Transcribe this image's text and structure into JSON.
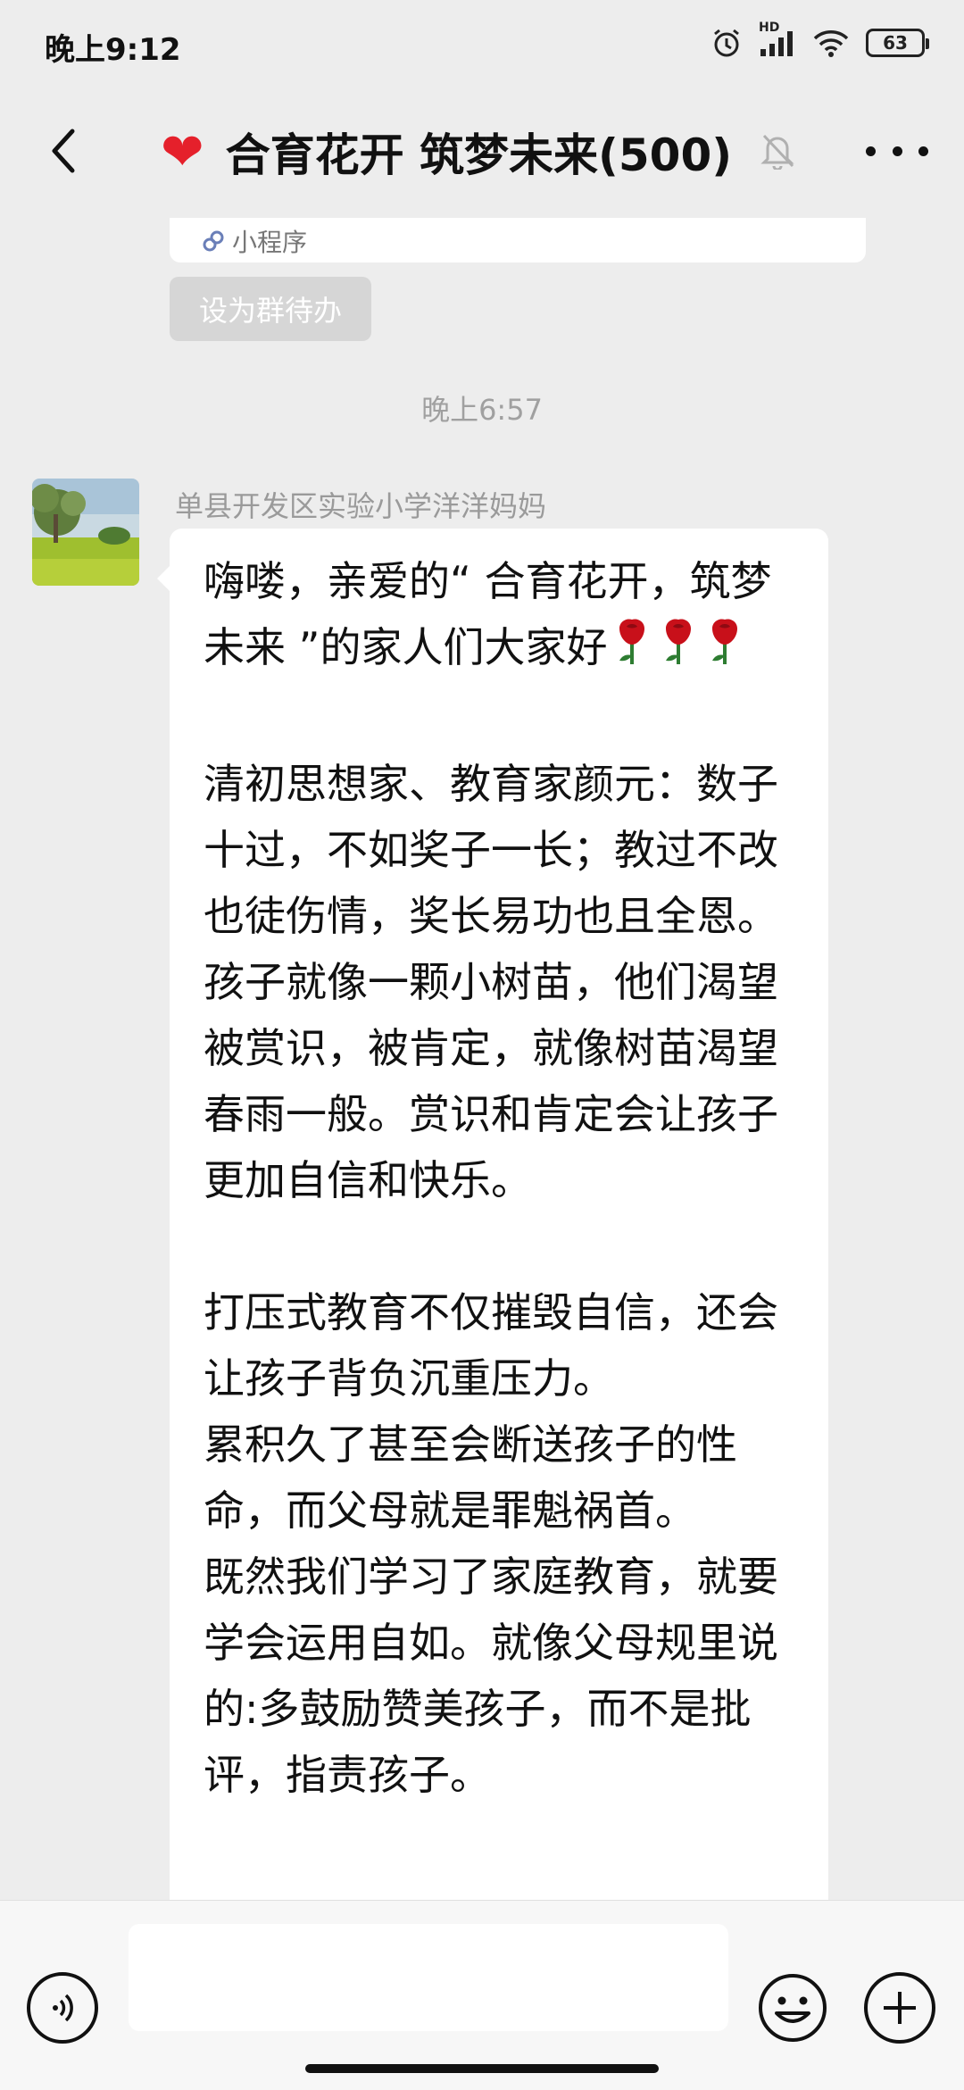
{
  "status_bar": {
    "time": "晚上9:12",
    "network": "HD",
    "battery": "63",
    "icons": [
      "alarm-icon",
      "signal-icon",
      "wifi-icon",
      "battery-icon"
    ]
  },
  "header": {
    "title": "合育花开 筑梦未来(500)",
    "heart": "❤",
    "icons": [
      "back-icon",
      "heart-emoji",
      "mute-bell-icon",
      "more-icon"
    ]
  },
  "chat": {
    "previous_card": {
      "mini_program_label": "小程序"
    },
    "todo_button": "设为群待办",
    "timestamp": "晚上6:57",
    "message": {
      "sender": "单县开发区实验小学洋洋妈妈",
      "paragraphs": [
        "嗨喽，亲爱的“ 合育花开，筑梦未来 ”的家人们大家好",
        "清初思想家、教育家颜元：数子十过，不如奖子一长；教过不改也徒伤情，奖长易功也且全恩。孩子就像一颗小树苗，他们渴望被赏识，被肯定，就像树苗渴望春雨一般。赏识和肯定会让孩子更加自信和快乐。",
        "打压式教育不仅摧毁自信，还会让孩子背负沉重压力。",
        "累积久了甚至会断送孩子的性命，而父母就是罪魁祸首。",
        "既然我们学习了家庭教育，就要学会运用自如。就像父母规里说的:多鼓励赞美孩子，而不是批评，指责孩子。"
      ],
      "emoji": "rose-emoji"
    }
  },
  "input_bar": {
    "input_value": "",
    "icons": [
      "voice-icon",
      "emoji-icon",
      "plus-icon"
    ]
  },
  "colors": {
    "background": "#ededed",
    "bubble": "#ffffff",
    "heart": "#e5202b",
    "rose": "#c8101a"
  }
}
